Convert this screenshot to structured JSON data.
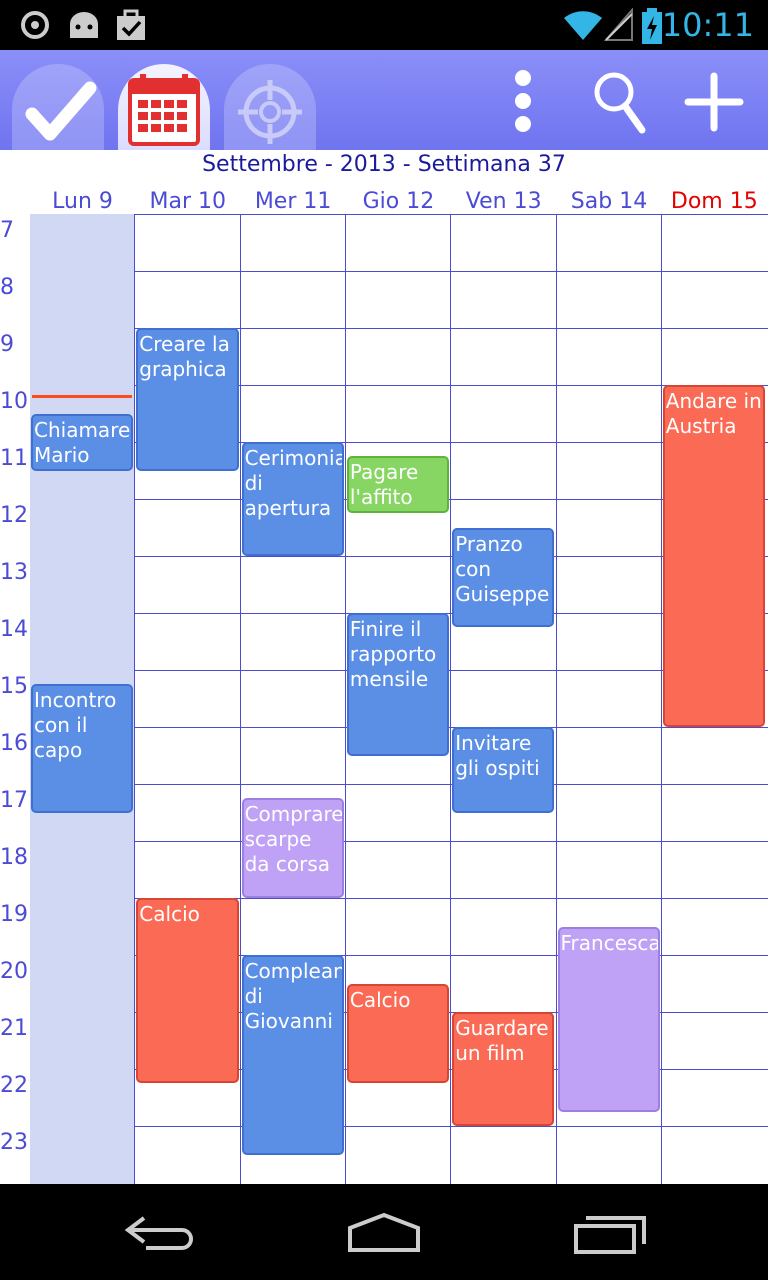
{
  "status": {
    "time": "10:11"
  },
  "toolbar": {
    "tabs": [
      {
        "name": "tasks",
        "icon": "checkmark-icon"
      },
      {
        "name": "calendar",
        "icon": "calendar-icon"
      },
      {
        "name": "target",
        "icon": "target-icon"
      }
    ],
    "actions": [
      "overflow-menu-icon",
      "search-icon",
      "add-icon"
    ]
  },
  "header": {
    "title": "Settembre - 2013 - Settimana 37"
  },
  "days": [
    "Lun 9",
    "Mar 10",
    "Mer 11",
    "Gio 12",
    "Ven 13",
    "Sab 14",
    "Dom 15"
  ],
  "hours": [
    "7",
    "8",
    "9",
    "10",
    "11",
    "12",
    "13",
    "14",
    "15",
    "16",
    "17",
    "18",
    "19",
    "20",
    "21",
    "22",
    "23"
  ],
  "events": [
    {
      "title": "Chiamare Mario",
      "day": "Lun 9",
      "start": "10:30",
      "end": "11:30",
      "color": "#5b8fe6"
    },
    {
      "title": "Incontro con il capo",
      "day": "Lun 9",
      "start": "15:15",
      "end": "17:30",
      "color": "#5b8fe6"
    },
    {
      "title": "Creare la graphica",
      "day": "Mar 10",
      "start": "9:00",
      "end": "11:30",
      "color": "#5b8fe6"
    },
    {
      "title": "Calcio",
      "day": "Mar 10",
      "start": "19:00",
      "end": "22:15",
      "color": "#fb6a55"
    },
    {
      "title": "Cerimonia di apertura",
      "day": "Mer 11",
      "start": "11:00",
      "end": "13:00",
      "color": "#5b8fe6"
    },
    {
      "title": "Comprare scarpe da corsa",
      "day": "Mer 11",
      "start": "17:15",
      "end": "19:00",
      "color": "#bfa2f6"
    },
    {
      "title": "Compleanno di Giovanni",
      "day": "Mer 11",
      "start": "20:00",
      "end": "23:30",
      "color": "#5b8fe6"
    },
    {
      "title": "Pagare l'affito",
      "day": "Gio 12",
      "start": "11:15",
      "end": "12:15",
      "color": "#87d563"
    },
    {
      "title": "Finire il rapporto mensile",
      "day": "Gio 12",
      "start": "14:00",
      "end": "16:30",
      "color": "#5b8fe6"
    },
    {
      "title": "Calcio",
      "day": "Gio 12",
      "start": "20:30",
      "end": "22:15",
      "color": "#fb6a55"
    },
    {
      "title": "Pranzo con Guiseppe",
      "day": "Ven 13",
      "start": "12:30",
      "end": "14:15",
      "color": "#5b8fe6"
    },
    {
      "title": "Invitare gli ospiti",
      "day": "Ven 13",
      "start": "16:00",
      "end": "17:30",
      "color": "#5b8fe6"
    },
    {
      "title": "Guardare un film",
      "day": "Ven 13",
      "start": "21:00",
      "end": "23:00",
      "color": "#fb6a55"
    },
    {
      "title": "Francesca",
      "day": "Sab 14",
      "start": "19:30",
      "end": "22:45",
      "color": "#bfa2f6"
    },
    {
      "title": "Andare in Austria",
      "day": "Dom 15",
      "start": "10:00",
      "end": "16:00",
      "color": "#fb6a55"
    }
  ],
  "colors": {
    "accent": "#6f74f0",
    "today_column": "#d0d8f4",
    "grid": "#4c4ccf",
    "sunday": "#e60000",
    "now_line": "#ff4a1a"
  }
}
